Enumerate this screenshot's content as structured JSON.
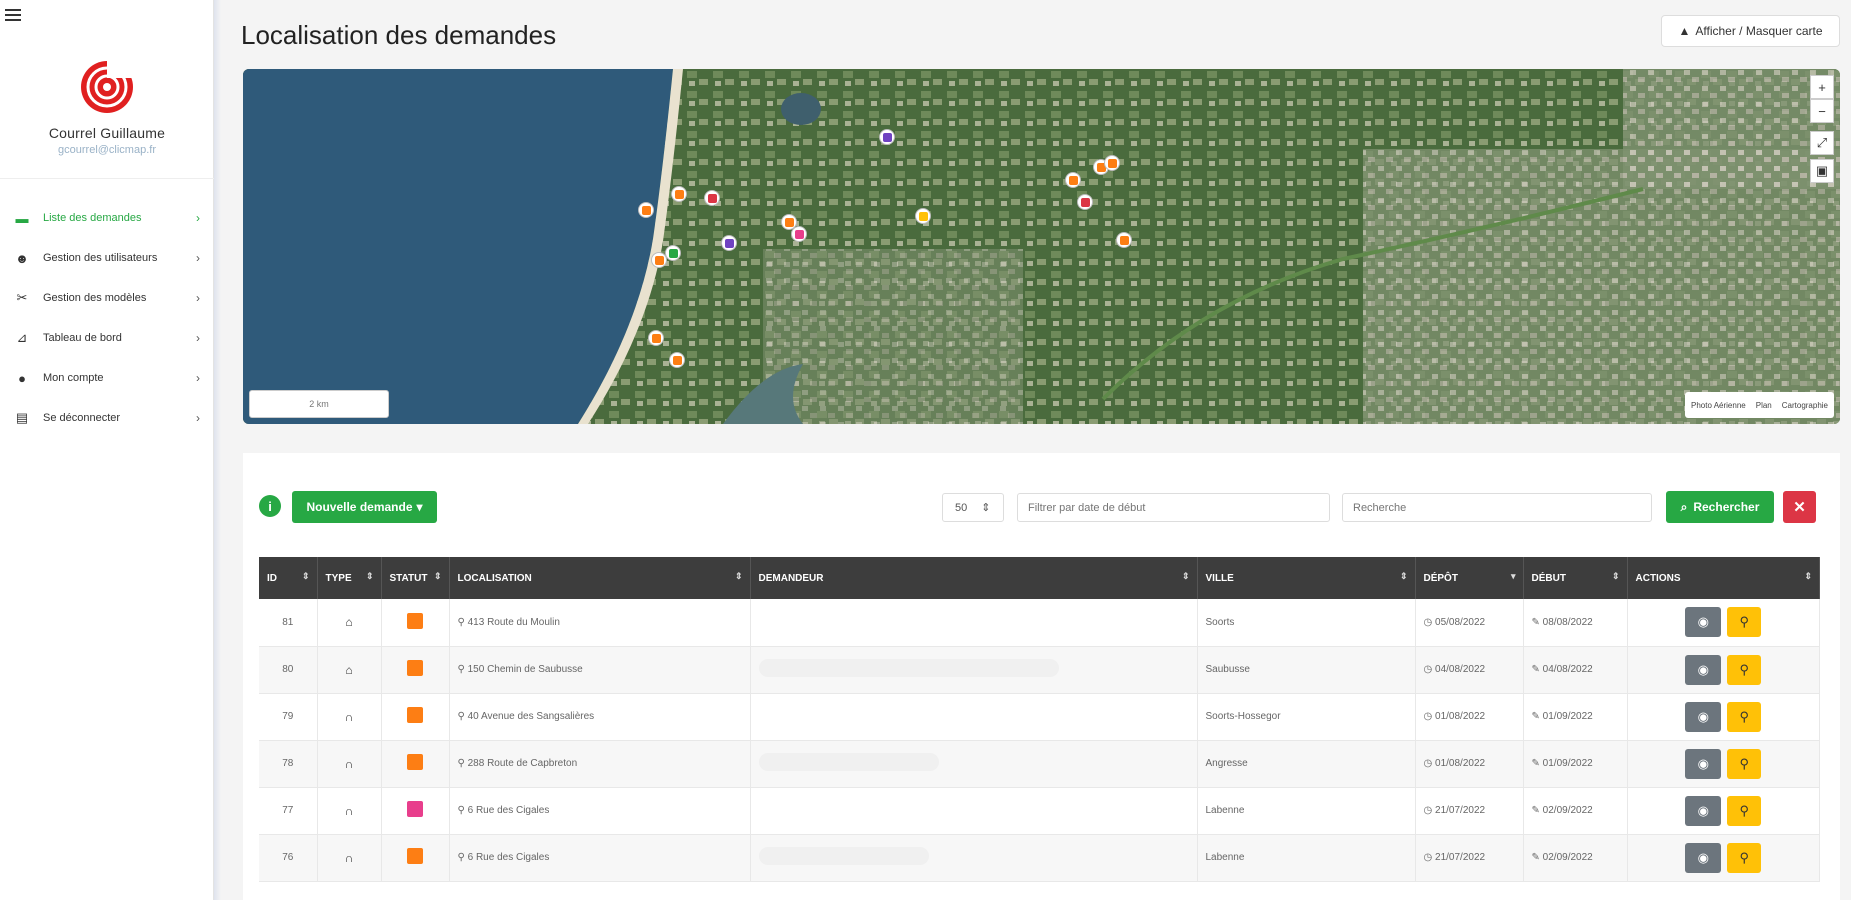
{
  "sidebar": {
    "user_name": "Courrel Guillaume",
    "user_email": "gcourrel@clicmap.fr",
    "items": [
      {
        "label": "Liste des demandes",
        "icon": "folder-icon",
        "active": true
      },
      {
        "label": "Gestion des utilisateurs",
        "icon": "users-icon",
        "active": false
      },
      {
        "label": "Gestion des modèles",
        "icon": "tools-icon",
        "active": false
      },
      {
        "label": "Tableau de bord",
        "icon": "chart-icon",
        "active": false
      },
      {
        "label": "Mon compte",
        "icon": "user-icon",
        "active": false
      },
      {
        "label": "Se déconnecter",
        "icon": "logout-icon",
        "active": false
      }
    ]
  },
  "header": {
    "title": "Localisation des demandes",
    "toggle_map_label": "Afficher / Masquer carte"
  },
  "map": {
    "scale_label": "2 km",
    "layers": [
      "Photo Aérienne",
      "Plan",
      "Cartographie"
    ],
    "zoom_in": "+",
    "zoom_out": "−"
  },
  "toolbar": {
    "info_label": "i",
    "new_request_label": "Nouvelle demande",
    "per_page": "50",
    "date_filter_placeholder": "Filtrer par date de début",
    "search_placeholder": "Recherche",
    "search_label": "Rechercher",
    "clear_label": "✕"
  },
  "table": {
    "headers": [
      "ID",
      "TYPE",
      "STATUT",
      "LOCALISATION",
      "DEMANDEUR",
      "VILLE",
      "DÉPÔT",
      "DÉBUT",
      "ACTIONS"
    ],
    "rows": [
      {
        "id": "81",
        "type_icon": "building-icon",
        "status_color": "#fd7e14",
        "location": "413 Route du Moulin",
        "requester": "",
        "city": "Soorts",
        "deposit": "05/08/2022",
        "start": "08/08/2022"
      },
      {
        "id": "80",
        "type_icon": "building-icon",
        "status_color": "#fd7e14",
        "location": "150 Chemin de Saubusse",
        "requester": "",
        "city": "Saubusse",
        "deposit": "04/08/2022",
        "start": "04/08/2022"
      },
      {
        "id": "79",
        "type_icon": "barrier-icon",
        "status_color": "#fd7e14",
        "location": "40 Avenue des Sangsalières",
        "requester": "",
        "city": "Soorts-Hossegor",
        "deposit": "01/08/2022",
        "start": "01/09/2022"
      },
      {
        "id": "78",
        "type_icon": "barrier-icon",
        "status_color": "#fd7e14",
        "location": "288 Route de Capbreton",
        "requester": "",
        "city": "Angresse",
        "deposit": "01/08/2022",
        "start": "01/09/2022"
      },
      {
        "id": "77",
        "type_icon": "barrier-icon",
        "status_color": "#e83e8c",
        "location": "6 Rue des Cigales",
        "requester": "",
        "city": "Labenne",
        "deposit": "21/07/2022",
        "start": "02/09/2022"
      },
      {
        "id": "76",
        "type_icon": "barrier-icon",
        "status_color": "#fd7e14",
        "location": "6 Rue des Cigales",
        "requester": "",
        "city": "Labenne",
        "deposit": "21/07/2022",
        "start": "02/09/2022"
      }
    ]
  },
  "colors": {
    "accent_green": "#27a844",
    "danger_red": "#dc3545",
    "warning_yellow": "#ffc107",
    "header_dark": "#3d3d3d",
    "logo_red": "#e02020"
  }
}
